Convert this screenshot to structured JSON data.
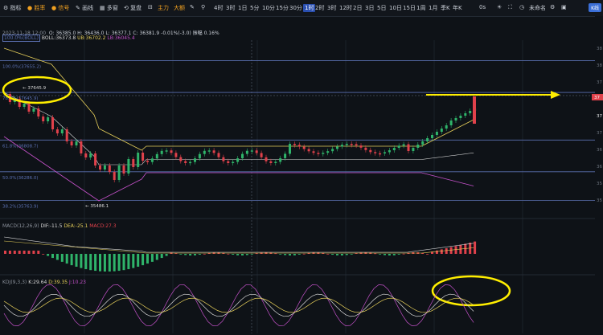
{
  "toolbar": {
    "left_items": [
      {
        "label": "指标",
        "icon": "indicator-icon"
      },
      {
        "label": "胜率",
        "icon": "winrate-icon",
        "orange": true
      },
      {
        "label": "信号",
        "icon": "signal-icon",
        "orange": true
      },
      {
        "label": "画线",
        "icon": "drawing-icon"
      },
      {
        "label": "多窗",
        "icon": "multi-window-icon"
      },
      {
        "label": "复盘",
        "icon": "replay-icon"
      }
    ],
    "main_label": "主力",
    "big_label": "大额",
    "intervals": [
      "4时",
      "3时",
      "1日",
      "5分",
      "10分",
      "15分",
      "30分",
      "1时",
      "2时",
      "3时",
      "12时",
      "2日",
      "3日",
      "5日",
      "10日",
      "15日",
      "1周",
      "1月",
      "季K",
      "年K"
    ],
    "active_interval": "1时",
    "seconds_label": "0s",
    "user_label": "未命名",
    "badge_label": "K线"
  },
  "info": {
    "datetime": "2023-11-18 12:00",
    "ohlc": "O: 36385.0  H: 36436.0  L: 36377.1  C: 36381.9  -0.01%(-3.0)  振幅 0.16%",
    "fib_label": "100.0%(BOLL)",
    "boll": "BOLL:36373.8",
    "boll_ub": "UB:36702.2",
    "boll_lb": "LB:36045.4",
    "macd_label": "MACD(12,26,9)",
    "macd_dif": "DIF:-11.5",
    "macd_dea": "DEA:-25.1",
    "macd_val": "MACD:27.3",
    "kdj_label": "KDJ(9,3,3)",
    "kdj_k": "K:29.64",
    "kdj_d": "D:39.35",
    "kdj_j": "J:10.23"
  },
  "fib_levels": [
    {
      "label": "100.0%(37655.2)",
      "y": 0.09
    },
    {
      "label": "78.6%(37645.9)",
      "y": 0.19
    },
    {
      "label": "61.8%(36808.7)",
      "y": 0.34
    },
    {
      "label": "50.0%(36286.0)",
      "y": 0.44
    },
    {
      "label": "38.2%(35763.9)",
      "y": 0.53
    }
  ],
  "annotations": {
    "high_label": "37645.9",
    "low_label": "35486.1",
    "price_tag_1": "37",
    "price_tag_2": "37"
  },
  "colors": {
    "up": "#2fb46a",
    "down": "#e0414b",
    "fib": "#5a6fb0",
    "highlight": "#ffee00"
  }
}
